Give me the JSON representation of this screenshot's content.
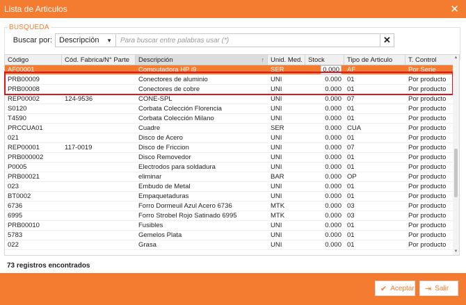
{
  "window": {
    "title": "Lista de Articulos",
    "close_icon": "close-icon"
  },
  "search": {
    "legend": "BUSQUEDA",
    "label": "Buscar por:",
    "field": "Descripción",
    "placeholder": "Para buscar entre palabras usar (*)",
    "clear_label": "✕"
  },
  "table": {
    "columns": [
      "Código",
      "Cód. Fabrica/N° Parte",
      "Descripción",
      "Unid. Med.",
      "Stock",
      "Tipo de Articulo",
      "T. Control"
    ],
    "sorted_column": 2,
    "rows": [
      [
        "AF00001",
        "",
        "Computadora HP i9",
        "SER",
        "0.000",
        "AF",
        "Por Serie"
      ],
      [
        "PRB00009",
        "",
        "Conectores de aluminio",
        "UNI",
        "0.000",
        "01",
        "Por producto"
      ],
      [
        "PRB00008",
        "",
        "Conectores de cobre",
        "UNI",
        "0.000",
        "01",
        "Por producto"
      ],
      [
        "REP00002",
        "124-9536",
        "CONE-SPL",
        "UNI",
        "0.000",
        "07",
        "Por producto"
      ],
      [
        "S0120",
        "",
        "Corbata Colección Florencia",
        "UNI",
        "0.000",
        "01",
        "Por producto"
      ],
      [
        "T4590",
        "",
        "Corbata Colección Milano",
        "UNI",
        "0.000",
        "01",
        "Por producto"
      ],
      [
        "PRCCUA01",
        "",
        "Cuadre",
        "SER",
        "0.000",
        "CUA",
        "Por producto"
      ],
      [
        "021",
        "",
        "Disco de Acero",
        "UNI",
        "0.000",
        "01",
        "Por producto"
      ],
      [
        "REP00001",
        "117-0019",
        "Disco de Friccion",
        "UNI",
        "0.000",
        "07",
        "Por producto"
      ],
      [
        "PRB000002",
        "",
        "Disco Removedor",
        "UNI",
        "0.000",
        "01",
        "Por producto"
      ],
      [
        "P0005",
        "",
        "Electrodos para soldadura",
        "UNI",
        "0.000",
        "01",
        "Por producto"
      ],
      [
        "PRB00021",
        "",
        "eliminar",
        "BAR",
        "0.000",
        "OP",
        "Por producto"
      ],
      [
        "023",
        "",
        "Embudo de Metal",
        "UNI",
        "0.000",
        "01",
        "Por producto"
      ],
      [
        "BT0002",
        "",
        "Empaquetaduras",
        "UNI",
        "0.000",
        "01",
        "Por producto"
      ],
      [
        "6736",
        "",
        "Forro Dormeuil Azul Acero 6736",
        "MTK",
        "0.000",
        "03",
        "Por producto"
      ],
      [
        "6995",
        "",
        "Forro Strobel Rojo Satinado 6995",
        "MTK",
        "0.000",
        "03",
        "Por producto"
      ],
      [
        "PRB00010",
        "",
        "Fusibles",
        "UNI",
        "0.000",
        "01",
        "Por producto"
      ],
      [
        "5783",
        "",
        "Gemelos Plata",
        "UNI",
        "0.000",
        "01",
        "Por producto"
      ],
      [
        "022",
        "",
        "Grasa",
        "UNI",
        "0.000",
        "01",
        "Por producto"
      ]
    ]
  },
  "status": {
    "count_text": "73 registros encontrados"
  },
  "footer": {
    "accept_label": "Aceptar",
    "exit_label": "Salir"
  },
  "colors": {
    "accent": "#f47c30",
    "highlight_border": "#e0121c"
  }
}
